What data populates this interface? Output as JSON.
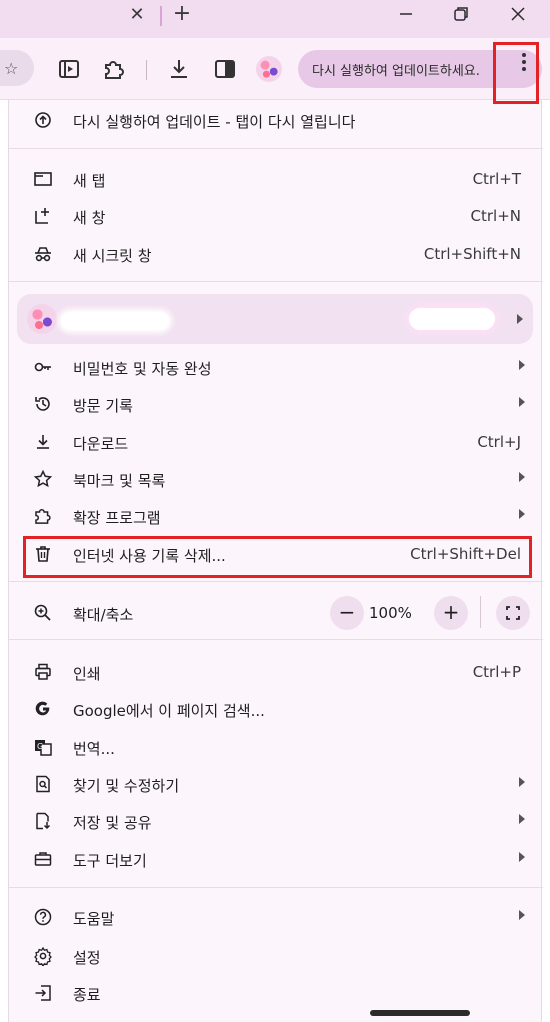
{
  "update_pill": {
    "label": "다시 실행하여 업데이트하세요."
  },
  "menu": {
    "update_item": {
      "label": "다시 실행하여 업데이트 - 탭이 다시 열립니다"
    },
    "new_tab": {
      "label": "새 탭",
      "shortcut": "Ctrl+T"
    },
    "new_window": {
      "label": "새 창",
      "shortcut": "Ctrl+N"
    },
    "incognito": {
      "label": "새 시크릿 창",
      "shortcut": "Ctrl+Shift+N"
    },
    "passwords": {
      "label": "비밀번호 및 자동 완성"
    },
    "history": {
      "label": "방문 기록"
    },
    "downloads": {
      "label": "다운로드",
      "shortcut": "Ctrl+J"
    },
    "bookmarks": {
      "label": "북마크 및 목록"
    },
    "extensions": {
      "label": "확장 프로그램"
    },
    "clear_data": {
      "label": "인터넷 사용 기록 삭제...",
      "shortcut": "Ctrl+Shift+Del"
    },
    "zoom": {
      "label": "확대/축소",
      "minus": "−",
      "value": "100%",
      "plus": "+"
    },
    "print": {
      "label": "인쇄",
      "shortcut": "Ctrl+P"
    },
    "google_search": {
      "label": "Google에서 이 페이지 검색..."
    },
    "translate": {
      "label": "번역..."
    },
    "find_edit": {
      "label": "찾기 및 수정하기"
    },
    "save_share": {
      "label": "저장 및 공유"
    },
    "more_tools": {
      "label": "도구 더보기"
    },
    "help": {
      "label": "도움말"
    },
    "settings": {
      "label": "설정"
    },
    "exit": {
      "label": "종료"
    }
  },
  "colors": {
    "highlight": "#e32226",
    "menu_bg": "#fdf5fc",
    "pill_bg": "#e7c9e7",
    "titlebar": "#f2dcf0"
  }
}
